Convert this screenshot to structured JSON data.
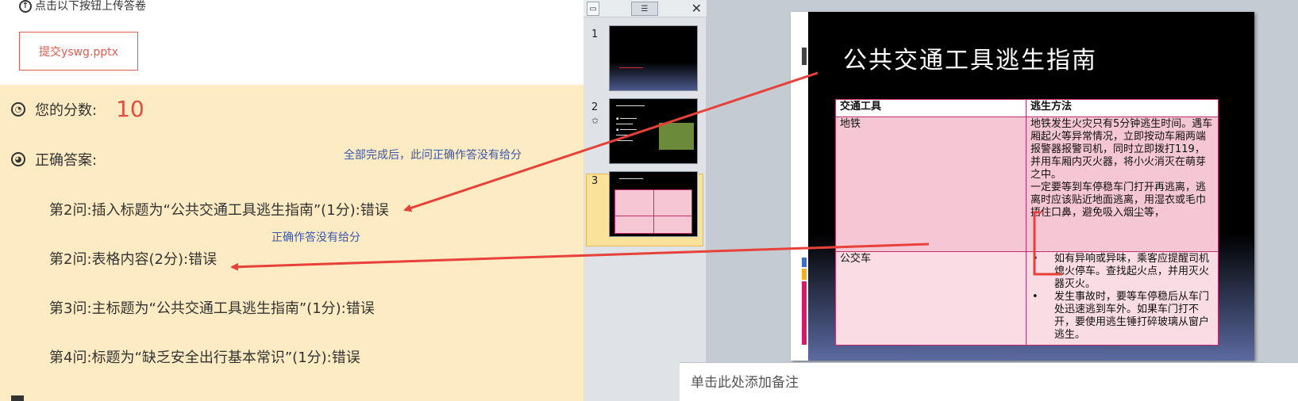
{
  "upload": {
    "hint": "点击以下按钮上传答卷",
    "submit_label": "提交yswg.pptx"
  },
  "result": {
    "score_label": "您的分数:",
    "score_value": "10",
    "answer_label": "正确答案:",
    "answers": [
      "第2问:插入标题为“公共交通工具逃生指南”(1分):错误",
      "第2问:表格内容(2分):错误",
      "第3问:主标题为“公共交通工具逃生指南”(1分):错误",
      "第4问:标题为“缺乏安全出行基本常识”(1分):错误"
    ],
    "notes": [
      "全部完成后，此问正确作答没有给分",
      "正确作答没有给分"
    ]
  },
  "thumbnails": {
    "slides": [
      {
        "number": "1"
      },
      {
        "number": "2"
      },
      {
        "number": "3"
      }
    ],
    "selected": 3
  },
  "slide": {
    "title": "公共交通工具逃生指南",
    "table": {
      "headers": [
        "交通工具",
        "逃生方法"
      ],
      "rows": [
        {
          "tool": "地铁",
          "method": [
            "地铁发生火灾只有5分钟逃生时间。遇车厢起火等异常情况，立即按动车厢两端报警器报警司机，同时立即拨打119，并用车厢内灭火器，将小火消灭在萌芽之中。",
            "一定要等到车停稳车门打开再逃离，逃离时应该贴近地面逃离，用湿衣或毛巾捂住口鼻，避免吸入烟尘等，"
          ]
        },
        {
          "tool": "公交车",
          "method": [
            "如有异响或异味，乘客应提醒司机熄火停车。查找起火点，并用灭火器灭火。",
            "发生事故时，要等车停稳后从车门处迅速逃到车外。如果车门打不开，要使用逃生锤打碎玻璃从窗户逃生。"
          ]
        }
      ]
    }
  },
  "notes_placeholder": "单击此处添加备注",
  "colors": {
    "accent_red": "#e24d3f",
    "panel_bg": "#fdebc3",
    "note_blue": "#3a57b0",
    "arrow_red": "#e8413a"
  }
}
